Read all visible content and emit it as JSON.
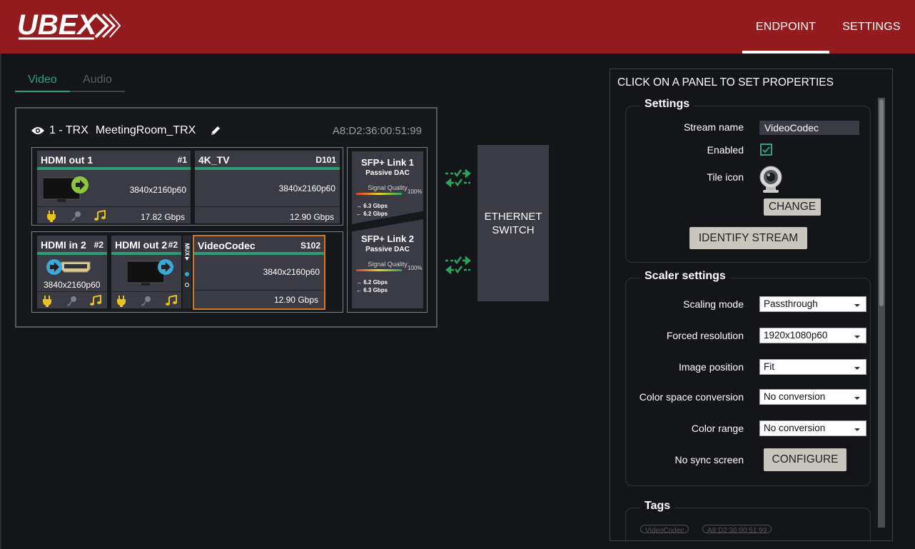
{
  "header": {
    "logo_text": "UBEX",
    "nav": [
      {
        "label": "ENDPOINT",
        "active": true
      },
      {
        "label": "SETTINGS",
        "active": false
      }
    ]
  },
  "tabs": [
    {
      "label": "Video",
      "active": true
    },
    {
      "label": "Audio",
      "active": false
    }
  ],
  "device": {
    "id_label": "1 - TRX",
    "name": "MeetingRoom_TRX",
    "mac": "A8:D2:36:00:51:99",
    "panels": {
      "hdmi_out1": {
        "title": "HDMI out 1",
        "num": "#1",
        "resolution": "3840x2160p60",
        "speed": "17.82 Gbps"
      },
      "tv": {
        "title": "4K_TV",
        "num": "D101",
        "resolution": "3840x2160p60",
        "speed": "12.90 Gbps"
      },
      "hdmi_in2": {
        "title": "HDMI in 2",
        "num": "#2",
        "resolution": "3840x2160p60"
      },
      "hdmi_out2": {
        "title": "HDMI out 2",
        "num": "#2"
      },
      "mux_label": "MUX",
      "codec": {
        "title": "VideoCodec",
        "num": "S102",
        "resolution": "3840x2160p60",
        "speed": "12.90 Gbps"
      }
    },
    "sfp": [
      {
        "title": "SFP+ Link 1",
        "subtitle": "Passive DAC",
        "quality_label": "Signal Quality",
        "quality_pct": "100%",
        "quality_value": 100,
        "tx": "6.3 Gbps",
        "rx": "6.2 Gbps"
      },
      {
        "title": "SFP+ Link 2",
        "subtitle": "Passive DAC",
        "quality_label": "Signal Quality",
        "quality_pct": "100%",
        "quality_value": 100,
        "tx": "6.2 Gbps",
        "rx": "6.3 Gbps"
      }
    ]
  },
  "switch": {
    "line1": "ETHERNET",
    "line2": "SWITCH"
  },
  "properties": {
    "heading": "CLICK ON A PANEL TO SET PROPERTIES",
    "settings": {
      "legend": "Settings",
      "stream_name_label": "Stream name",
      "stream_name_value": "VideoCodec",
      "enabled_label": "Enabled",
      "enabled": true,
      "tile_icon_label": "Tile icon",
      "change_button": "CHANGE",
      "identify_button": "IDENTIFY STREAM"
    },
    "scaler": {
      "legend": "Scaler settings",
      "scaling_mode_label": "Scaling mode",
      "scaling_mode_value": "Passthrough",
      "forced_res_label": "Forced resolution",
      "forced_res_value": "1920x1080p60",
      "image_pos_label": "Image position",
      "image_pos_value": "Fit",
      "csc_label": "Color space conversion",
      "csc_value": "No conversion",
      "color_range_label": "Color range",
      "color_range_value": "No conversion",
      "no_sync_label": "No sync screen",
      "configure_button": "CONFIGURE"
    },
    "tags": {
      "legend": "Tags",
      "items": [
        "VideoCodec",
        "A8:D2:36:00:51:99"
      ]
    }
  },
  "colors": {
    "header_bg": "#951c1e",
    "accent_green": "#2aa57a",
    "selected_orange": "#d9731f",
    "panel_bg": "#3a3b44",
    "icon_yellow": "#e8c21d"
  }
}
